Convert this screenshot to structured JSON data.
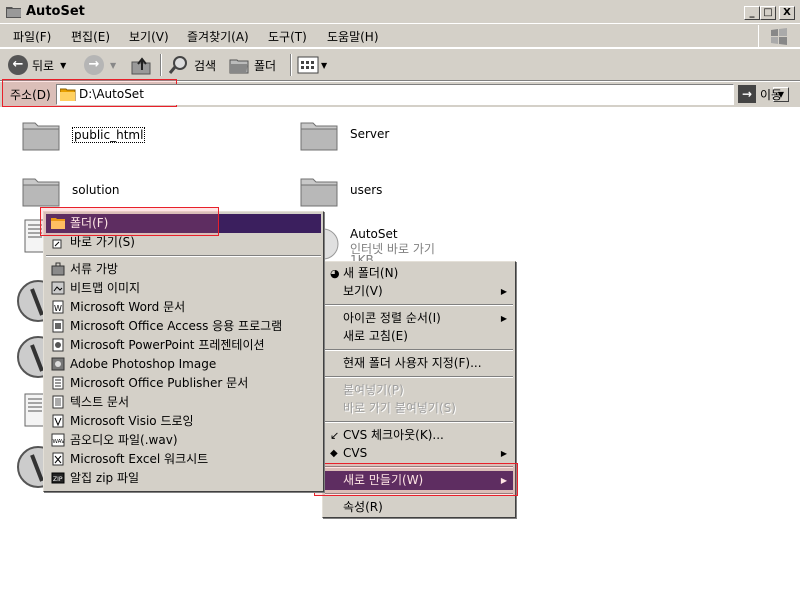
{
  "window": {
    "title": "AutoSet",
    "min_label": "_",
    "max_label": "□",
    "close_label": "X"
  },
  "menubar": {
    "items": [
      "파일(F)",
      "편집(E)",
      "보기(V)",
      "즐겨찾기(A)",
      "도구(T)",
      "도움말(H)"
    ]
  },
  "toolbar": {
    "back_label": "뒤로",
    "search_label": "검색",
    "folders_label": "폴더"
  },
  "address": {
    "label": "주소(D)",
    "path": "D:\\AutoSet",
    "go_label": "이동"
  },
  "files": [
    {
      "name": "public_html",
      "type": "folder"
    },
    {
      "name": "Server",
      "type": "folder"
    },
    {
      "name": "solution",
      "type": "folder"
    },
    {
      "name": "users",
      "type": "folder"
    },
    {
      "name": "AutoSet",
      "type": "shortcut",
      "desc": "인터넷 바로 가기",
      "size": "1KB"
    }
  ],
  "new_submenu": {
    "items": [
      {
        "label": "폴더(F)",
        "highlight": true
      },
      {
        "label": "바로 가기(S)"
      },
      {
        "separator": true
      },
      {
        "label": "서류 가방"
      },
      {
        "label": "비트맵 이미지"
      },
      {
        "label": "Microsoft Word 문서"
      },
      {
        "label": "Microsoft Office Access 응용 프로그램"
      },
      {
        "label": "Microsoft PowerPoint 프레젠테이션"
      },
      {
        "label": "Adobe Photoshop Image"
      },
      {
        "label": "Microsoft Office Publisher 문서"
      },
      {
        "label": "텍스트 문서"
      },
      {
        "label": "Microsoft Visio 드로잉"
      },
      {
        "label": "곰오디오 파일(.wav)"
      },
      {
        "label": "Microsoft Excel 워크시트"
      },
      {
        "label": "알집 zip 파일"
      }
    ]
  },
  "context_menu": {
    "items": [
      {
        "label": "새 폴더(N)"
      },
      {
        "label": "보기(V)",
        "submenu": true
      },
      {
        "separator": true
      },
      {
        "label": "아이콘 정렬 순서(I)",
        "submenu": true
      },
      {
        "label": "새로 고침(E)"
      },
      {
        "separator": true
      },
      {
        "label": "현재 폴더 사용자 지정(F)..."
      },
      {
        "separator": true
      },
      {
        "label": "붙여넣기(P)",
        "disabled": true
      },
      {
        "label": "바로 가기 붙여넣기(S)",
        "disabled": true
      },
      {
        "separator": true
      },
      {
        "label": "CVS 체크아웃(K)..."
      },
      {
        "label": "CVS",
        "submenu": true
      },
      {
        "separator": true
      },
      {
        "label": "새로 만들기(W)",
        "submenu": true,
        "highlight": true
      },
      {
        "separator": true
      },
      {
        "label": "속성(R)"
      }
    ]
  },
  "colors": {
    "highlight": "#3b1f5e",
    "annotation_red": "#e8202a",
    "chrome": "#d4d0c8"
  }
}
